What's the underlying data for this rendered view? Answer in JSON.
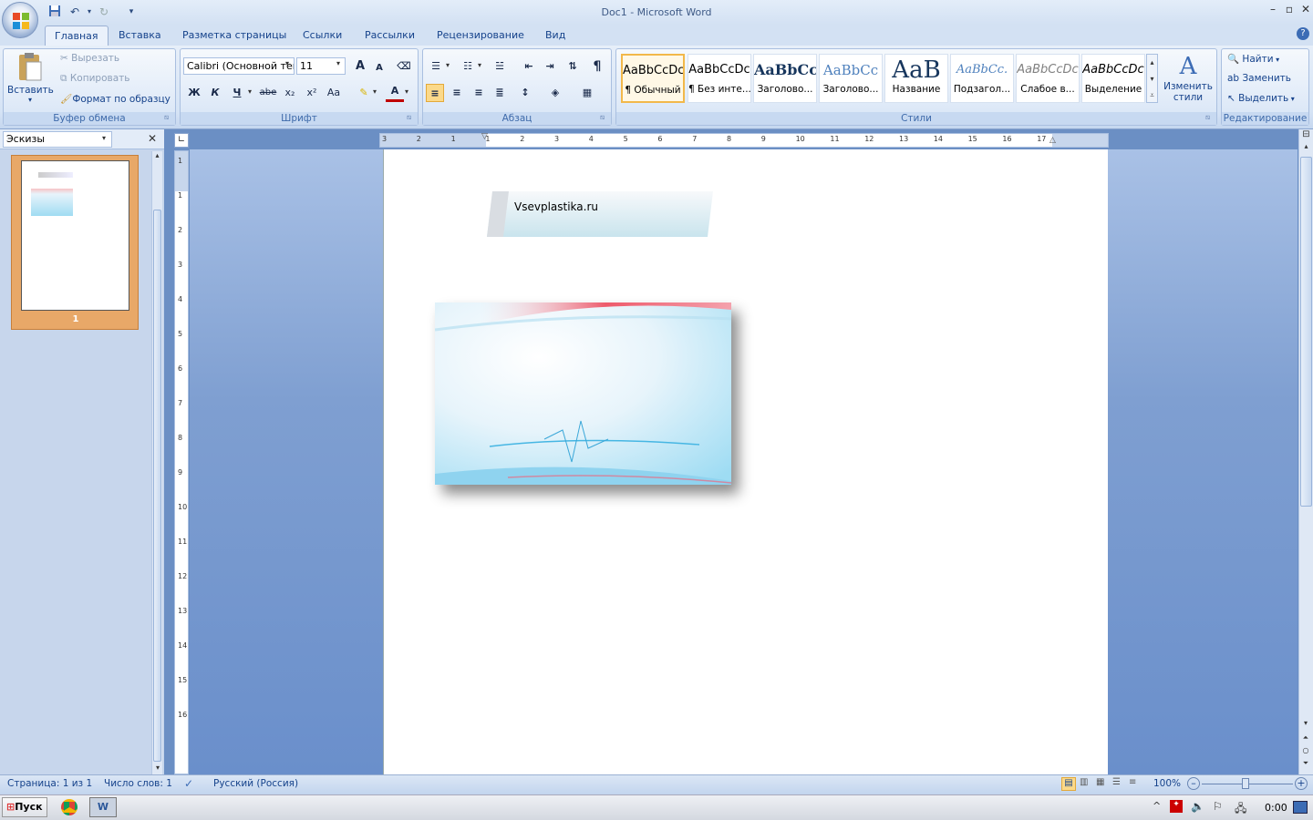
{
  "window": {
    "title": "Doc1 - Microsoft Word"
  },
  "qat": {
    "save_icon": "save-icon",
    "undo_icon": "undo-icon",
    "redo_icon": "redo-icon",
    "customize_icon": "customize-qat-icon"
  },
  "tabs": [
    "Главная",
    "Вставка",
    "Разметка страницы",
    "Ссылки",
    "Рассылки",
    "Рецензирование",
    "Вид"
  ],
  "ribbon": {
    "clipboard": {
      "label": "Буфер обмена",
      "paste": "Вставить",
      "cut": "Вырезать",
      "copy": "Копировать",
      "format_painter": "Формат по образцу"
    },
    "font": {
      "label": "Шрифт",
      "font_name": "Calibri (Основной текст)",
      "font_size": "11",
      "grow": "A",
      "shrink": "A",
      "bold": "Ж",
      "italic": "К",
      "underline": "Ч",
      "strike": "abe",
      "subscript": "x₂",
      "superscript": "x²",
      "change_case": "Aa",
      "font_color": "A"
    },
    "paragraph": {
      "label": "Абзац",
      "pilcrow": "¶"
    },
    "styles": {
      "label": "Стили",
      "change_styles": "Изменить стили",
      "items": [
        {
          "sample": "AaBbCcDc",
          "name": "¶ Обычный"
        },
        {
          "sample": "AaBbCcDc",
          "name": "¶ Без инте..."
        },
        {
          "sample": "AaBbCc",
          "name": "Заголово..."
        },
        {
          "sample": "AaBbCc",
          "name": "Заголово..."
        },
        {
          "sample": "AaB",
          "name": "Название"
        },
        {
          "sample": "AaBbCc.",
          "name": "Подзагол..."
        },
        {
          "sample": "AaBbCcDc",
          "name": "Слабое в..."
        },
        {
          "sample": "AaBbCcDc",
          "name": "Выделение"
        }
      ]
    },
    "editing": {
      "label": "Редактирование",
      "find": "Найти",
      "replace": "Заменить",
      "select": "Выделить"
    }
  },
  "thumbnails": {
    "pane_title": "Эскизы",
    "page_number": "1"
  },
  "ruler": {
    "h_labels": [
      "3",
      "2",
      "1",
      "1",
      "2",
      "3",
      "4",
      "5",
      "6",
      "7",
      "8",
      "9",
      "10",
      "11",
      "12",
      "13",
      "14",
      "15",
      "16",
      "17"
    ],
    "v_labels": [
      "1",
      "1",
      "2",
      "3",
      "4",
      "5",
      "6",
      "7",
      "8",
      "9",
      "10",
      "11",
      "12",
      "13",
      "14",
      "15",
      "16"
    ]
  },
  "document": {
    "header_text": "Vsevplastika.ru"
  },
  "status": {
    "page": "Страница: 1 из 1",
    "words": "Число слов: 1",
    "language": "Русский (Россия)",
    "zoom": "100%"
  },
  "taskbar": {
    "start": "Пуск",
    "clock": "0:00"
  },
  "colors": {
    "ribbon_bg": "#dbe6f5",
    "accent": "#15428b",
    "active_style_border": "#f2b84a",
    "thumb_selected": "#e8a868"
  }
}
